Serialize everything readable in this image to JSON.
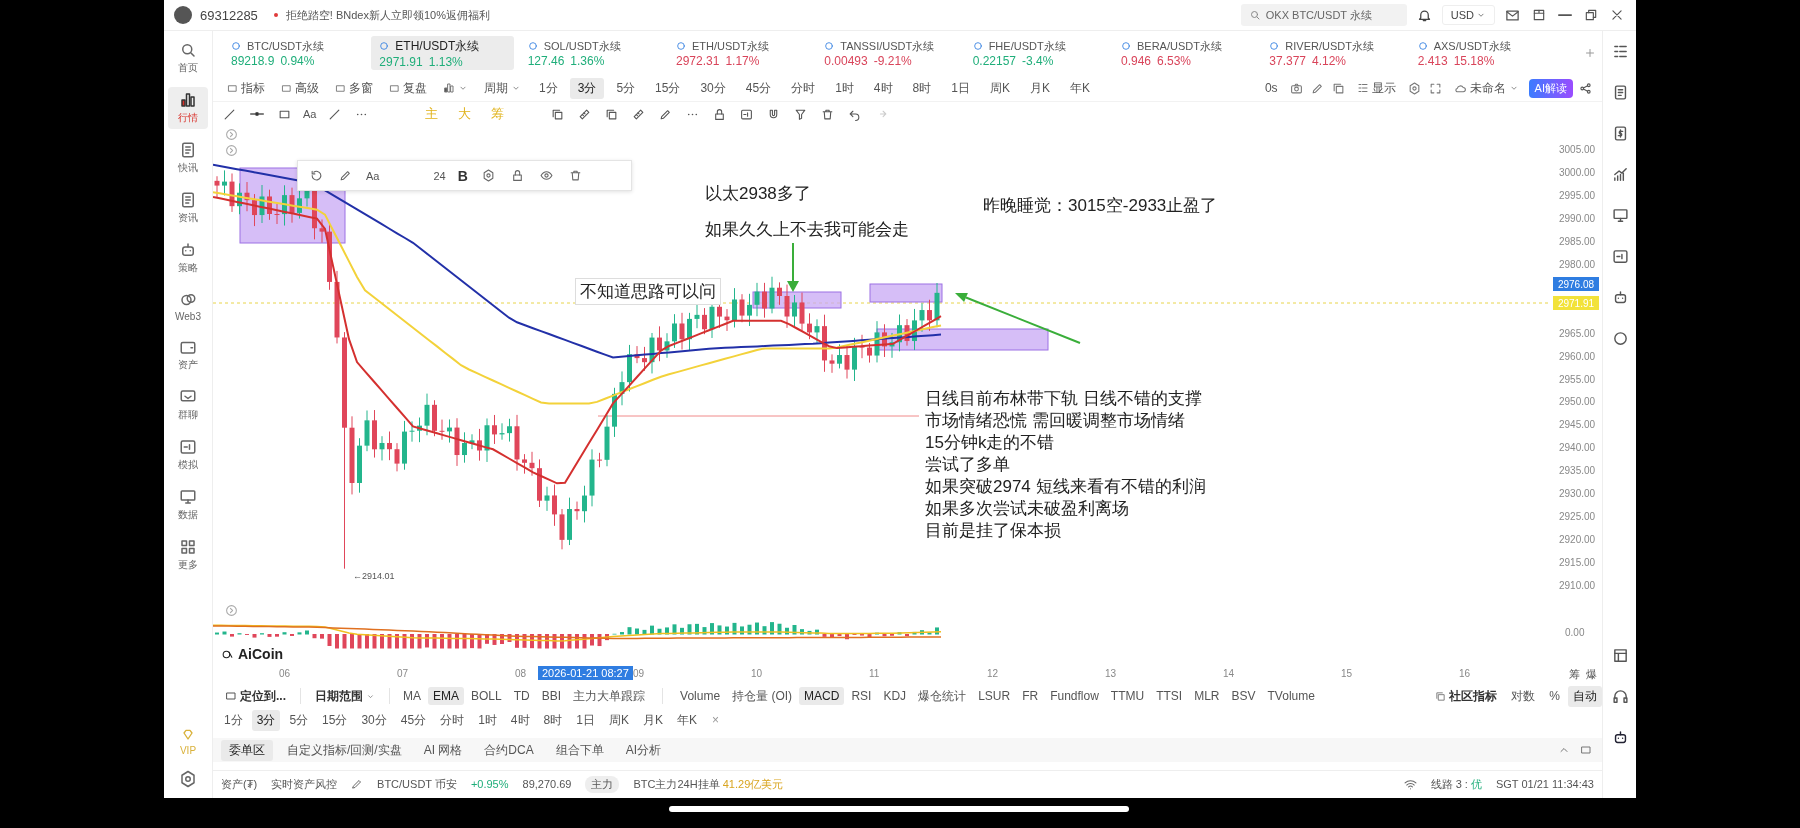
{
  "header": {
    "user_id": "69312285",
    "promo": "拒绝踏空! BNdex新人立即领10%返佣福利",
    "search": {
      "value": "OKX BTC/USDT 永续"
    },
    "currency": "USD"
  },
  "sidebar": {
    "items": [
      {
        "label": "首页",
        "selected": false
      },
      {
        "label": "行情",
        "selected": true
      },
      {
        "label": "快讯",
        "selected": false
      },
      {
        "label": "资讯",
        "selected": false
      },
      {
        "label": "策略",
        "selected": false
      },
      {
        "label": "Web3",
        "selected": false
      },
      {
        "label": "资产",
        "selected": false
      },
      {
        "label": "群聊",
        "selected": false
      },
      {
        "label": "模拟",
        "selected": false
      },
      {
        "label": "数据",
        "selected": false
      },
      {
        "label": "更多",
        "selected": false
      }
    ],
    "vip": "VIP"
  },
  "tickers": [
    {
      "symbol": "BTC/USDT永续",
      "price": "89218.9",
      "change": "0.94%",
      "color": "#1fae7a",
      "selected": false
    },
    {
      "symbol": "ETH/USDT永续",
      "price": "2971.91",
      "change": "1.13%",
      "color": "#1fae7a",
      "selected": true
    },
    {
      "symbol": "SOL/USDT永续",
      "price": "127.46",
      "change": "1.36%",
      "color": "#1fae7a",
      "selected": false
    },
    {
      "symbol": "ETH/USDT永续",
      "price": "2972.31",
      "change": "1.17%",
      "color": "#d9445a",
      "selected": false
    },
    {
      "symbol": "TANSSI/USDT永续",
      "price": "0.00493",
      "change": "-9.21%",
      "color": "#d9445a",
      "selected": false
    },
    {
      "symbol": "FHE/USDT永续",
      "price": "0.22157",
      "change": "-3.4%",
      "color": "#1fae7a",
      "selected": false
    },
    {
      "symbol": "BERA/USDT永续",
      "price": "0.946",
      "change": "6.53%",
      "color": "#d9445a",
      "selected": false
    },
    {
      "symbol": "RIVER/USDT永续",
      "price": "37.377",
      "change": "4.12%",
      "color": "#d9445a",
      "selected": false
    },
    {
      "symbol": "AXS/USDT永续",
      "price": "2.413",
      "change": "15.18%",
      "color": "#d9445a",
      "selected": false
    }
  ],
  "toolbar": {
    "tools": [
      "指标",
      "高级",
      "多窗",
      "复盘"
    ],
    "period_label": "周期",
    "periods": [
      {
        "label": "1分",
        "selected": false
      },
      {
        "label": "3分",
        "selected": true
      },
      {
        "label": "5分",
        "selected": false
      },
      {
        "label": "15分",
        "selected": false
      },
      {
        "label": "30分",
        "selected": false
      },
      {
        "label": "45分",
        "selected": false
      },
      {
        "label": "分时",
        "selected": false
      },
      {
        "label": "1时",
        "selected": false
      },
      {
        "label": "4时",
        "selected": false
      },
      {
        "label": "8时",
        "selected": false
      },
      {
        "label": "1日",
        "selected": false
      },
      {
        "label": "周K",
        "selected": false
      },
      {
        "label": "月K",
        "selected": false
      },
      {
        "label": "年K",
        "selected": false
      }
    ],
    "timer": "0s",
    "display": "显示",
    "layout": "未命名",
    "ai": "AI解读"
  },
  "drawing_tools": {
    "text_tool": "Aa",
    "marks": [
      "主",
      "大",
      "筹"
    ]
  },
  "chart": {
    "float_toolbar": {
      "text_tool": "Aa",
      "size": "24",
      "bold": "B"
    },
    "price_ticks": [
      "3005.00",
      "3000.00",
      "2995.00",
      "2990.00",
      "2985.00",
      "2980.00",
      "2965.00",
      "2960.00",
      "2955.00",
      "2950.00",
      "2945.00",
      "2940.00",
      "2935.00",
      "2930.00",
      "2925.00",
      "2920.00",
      "2915.00",
      "2910.00"
    ],
    "price_tags": [
      {
        "value": "2976.08",
        "kind": "cursor"
      },
      {
        "value": "2971.91",
        "kind": "last"
      }
    ],
    "low_label": "←2914.01",
    "annotations": [
      {
        "text": "以太2938多了",
        "boxed": false
      },
      {
        "text": "如果久久上不去我可能会走",
        "boxed": false
      },
      {
        "text": "昨晚睡觉：3015空-2933止盈了",
        "boxed": false
      },
      {
        "text": "不知道思路可以问",
        "boxed": true
      }
    ],
    "notes": [
      "日线目前布林带下轨 日线不错的支撑",
      "市场情绪恐慌 需回暖调整市场情绪",
      "15分钟k走的不错",
      "尝试了多单",
      "如果突破2974 短线来看有不错的利润",
      "如果多次尝试未破盈利离场",
      "目前是挂了保本损"
    ],
    "macd_zero": "0.00",
    "logo": "AiCoin",
    "time_labels": [
      "06",
      "07",
      "08",
      "09",
      "10",
      "11",
      "12",
      "13",
      "14",
      "15",
      "16"
    ],
    "cursor_time": "2026-01-21 08:27",
    "axis_marks": [
      "筹",
      "爆"
    ]
  },
  "indicators": {
    "locate": "定位到...",
    "date_range": "日期范围",
    "main": [
      {
        "label": "MA",
        "selected": false
      },
      {
        "label": "EMA",
        "selected": true
      },
      {
        "label": "BOLL",
        "selected": false
      },
      {
        "label": "TD",
        "selected": false
      },
      {
        "label": "BBI",
        "selected": false
      },
      {
        "label": "主力大单跟踪",
        "selected": false
      }
    ],
    "sub": [
      {
        "label": "Volume",
        "selected": false
      },
      {
        "label": "持仓量 (OI)",
        "selected": false
      },
      {
        "label": "MACD",
        "selected": true
      },
      {
        "label": "RSI",
        "selected": false
      },
      {
        "label": "KDJ",
        "selected": false
      },
      {
        "label": "爆仓统计",
        "selected": false
      },
      {
        "label": "LSUR",
        "selected": false
      },
      {
        "label": "FR",
        "selected": false
      },
      {
        "label": "Fundflow",
        "selected": false
      },
      {
        "label": "TTMU",
        "selected": false
      },
      {
        "label": "TTSI",
        "selected": false
      },
      {
        "label": "MLR",
        "selected": false
      },
      {
        "label": "BSV",
        "selected": false
      },
      {
        "label": "TVolume",
        "selected": false
      }
    ],
    "community": "社区指标",
    "log": "对数",
    "percent": "%",
    "auto": {
      "label": "自动",
      "selected": true
    }
  },
  "period_bar": {
    "periods": [
      {
        "label": "1分",
        "selected": false
      },
      {
        "label": "3分",
        "selected": true
      },
      {
        "label": "5分",
        "selected": false
      },
      {
        "label": "15分",
        "selected": false
      },
      {
        "label": "30分",
        "selected": false
      },
      {
        "label": "45分",
        "selected": false
      },
      {
        "label": "分时",
        "selected": false
      },
      {
        "label": "1时",
        "selected": false
      },
      {
        "label": "4时",
        "selected": false
      },
      {
        "label": "8时",
        "selected": false
      },
      {
        "label": "1日",
        "selected": false
      },
      {
        "label": "周K",
        "selected": false
      },
      {
        "label": "月K",
        "selected": false
      },
      {
        "label": "年K",
        "selected": false
      }
    ],
    "close": "×"
  },
  "panel_tabs": [
    {
      "label": "委单区",
      "selected": true
    },
    {
      "label": "自定义指标/回测/实盘",
      "selected": false
    },
    {
      "label": "AI 网格",
      "selected": false
    },
    {
      "label": "合约DCA",
      "selected": false
    },
    {
      "label": "组合下单",
      "selected": false
    },
    {
      "label": "AI分析",
      "selected": false
    }
  ],
  "status_bar": {
    "assets": "资产(₮)",
    "risk": "实时资产风控",
    "pair": "BTC/USDT 币安",
    "change": "+0.95%",
    "price": "89,270.69",
    "badge": "主力",
    "orders_label": "BTC主力24H挂单",
    "orders_value": "41.29亿美元",
    "line": "线路 3 : ",
    "line_quality": "优",
    "time": "SGT 01/21 11:34:43"
  }
}
